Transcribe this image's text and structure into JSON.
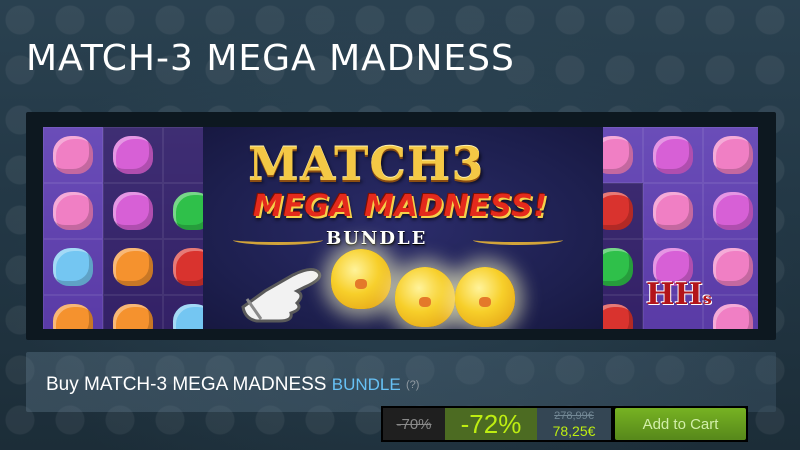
{
  "page": {
    "title": "MATCH-3 MEGA MADNESS"
  },
  "banner": {
    "logo_line1": "MATCH3",
    "logo_line2": "MEGA MADNESS!",
    "logo_line3": "BUNDLE",
    "publisher_badge": "HH",
    "publisher_badge_small": "s"
  },
  "purchase": {
    "prefix": "Buy MATCH-3 MEGA MADNESS",
    "bundle_label": "BUNDLE",
    "help": "(?)",
    "original_discount": "-70%",
    "discount": "-72%",
    "original_price": "278,99€",
    "final_price": "78,25€",
    "add_to_cart": "Add to Cart"
  },
  "colors": {
    "background": "#1b2838",
    "discount_green": "#beee11",
    "cart_button": "#75b022",
    "bundle_blue": "#67c1f5"
  }
}
